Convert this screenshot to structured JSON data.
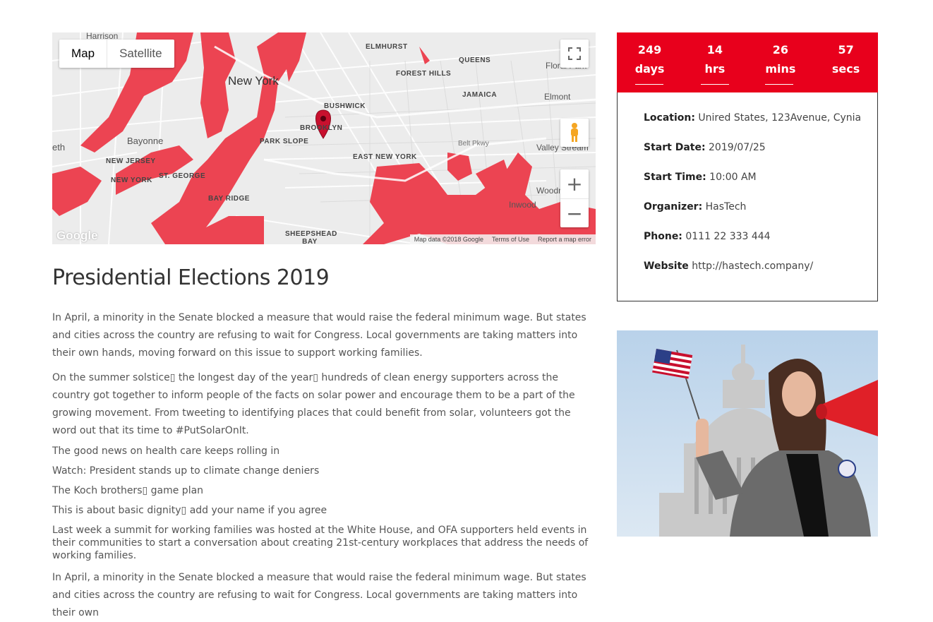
{
  "map": {
    "type_buttons": [
      "Map",
      "Satellite"
    ],
    "labels": {
      "harrison": "Harrison",
      "new_york": "New York",
      "elmhurst": "ELMHURST",
      "queens": "QUEENS",
      "forest_hills": "FOREST HILLS",
      "floral_park": "Floral Park",
      "jamaica": "JAMAICA",
      "elmont": "Elmont",
      "bushwick": "BUSHWICK",
      "brooklyn": "BROOKLYN",
      "park_slope": "PARK SLOPE",
      "bayonne": "Bayonne",
      "new_jersey": "NEW JERSEY",
      "new_york_nj": "NEW YORK",
      "st_george": "ST. GEORGE",
      "east_new_york": "EAST NEW YORK",
      "belt_pkwy": "Belt Pkwy",
      "valley_stream": "Valley Stream",
      "bay_ridge": "BAY RIDGE",
      "woodmere": "Woodm",
      "inwood": "Inwood",
      "sheepshead_bay": "SHEEPSHEAD BAY",
      "eth": "eth"
    },
    "logo": "Google",
    "attribution": [
      "Map data ©2018 Google",
      "Terms of Use",
      "Report a map error"
    ],
    "zoom_in": "+",
    "zoom_out": "−"
  },
  "event": {
    "title": "Presidential Elections 2019",
    "paragraphs": [
      "In April, a minority in the Senate blocked a measure that would raise the federal minimum wage. But states and cities across the country are refusing to wait for Congress. Local governments are taking matters into their own hands, moving forward on this issue to support working families.",
      "On the summer solstice▯ the longest day of the year▯ hundreds of clean energy supporters across the country got together to inform people of the facts on solar power and encourage them to be a part of the growing movement. From tweeting to identifying places that could benefit from solar, volunteers got the word out that its time to #PutSolarOnIt.",
      "The good news on health care keeps rolling in",
      "Watch: President stands up to climate change deniers",
      "The Koch brothers▯ game plan",
      "This is about basic dignity▯ add your name if you agree",
      "Last week a summit for working families was hosted at the White House, and OFA supporters held events in their communities to start a conversation about creating 21st-century workplaces that address the needs of working families.",
      "In April, a minority in the Senate blocked a measure that would raise the federal minimum wage. But states and cities across the country are refusing to wait for Congress. Local governments are taking matters into their own"
    ]
  },
  "countdown": [
    {
      "value": "249",
      "unit": "days"
    },
    {
      "value": "14",
      "unit": "hrs"
    },
    {
      "value": "26",
      "unit": "mins"
    },
    {
      "value": "57",
      "unit": "secs"
    }
  ],
  "details": [
    {
      "label": "Location:",
      "value": " Unired States, 123Avenue, Cynia"
    },
    {
      "label": "Start Date:",
      "value": " 2019/07/25"
    },
    {
      "label": "Start Time:",
      "value": " 10:00 AM"
    },
    {
      "label": "Organizer:",
      "value": " HasTech"
    },
    {
      "label": "Phone:",
      "value": " 0111 22 333 444"
    },
    {
      "label": "Website",
      "value": " http://hastech.company/"
    }
  ],
  "colors": {
    "accent": "#e8001c",
    "water": "#ec4452",
    "land": "#ececec"
  }
}
